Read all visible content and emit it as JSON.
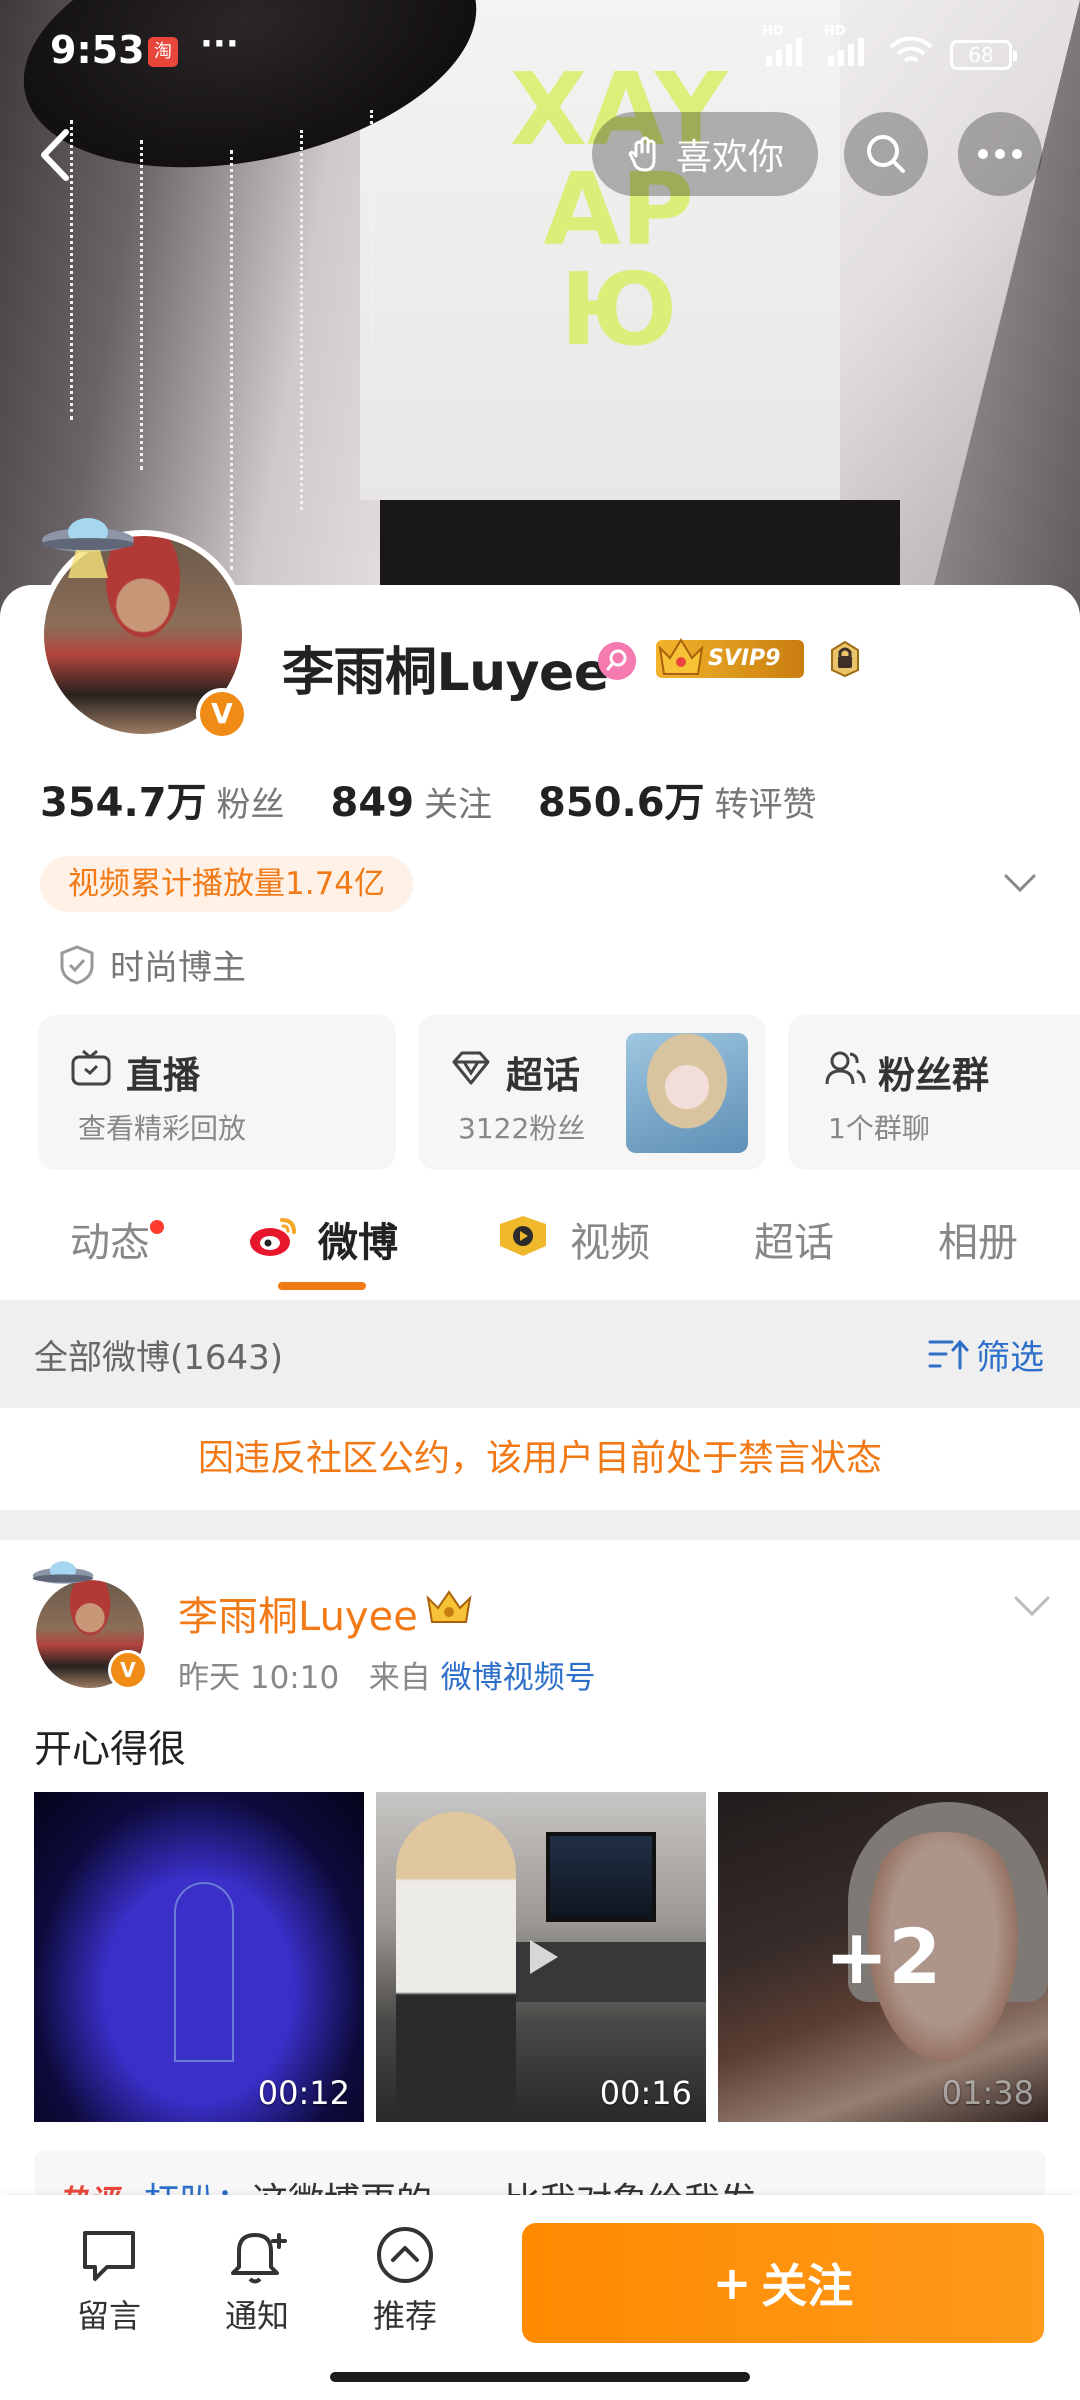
{
  "status_bar": {
    "time": "9:53",
    "app_icon_label": "淘",
    "more": "···",
    "battery": "68",
    "signal1_label": "HD",
    "signal2_label": "HD"
  },
  "header": {
    "like_label": "喜欢你",
    "shirt_text": [
      "XAY",
      "AP",
      "Ю"
    ]
  },
  "profile": {
    "name": "李雨桐Luyee",
    "svip_label": "SVIP9",
    "verified_badge": "V",
    "stats": [
      {
        "value": "354.7万",
        "label": "粉丝"
      },
      {
        "value": "849",
        "label": "关注"
      },
      {
        "value": "850.6万",
        "label": "转评赞"
      }
    ],
    "play_count": "视频累计播放量1.74亿",
    "tag": "时尚博主"
  },
  "features": [
    {
      "title": "直播",
      "sub": "查看精彩回放",
      "icon": "tv-icon"
    },
    {
      "title": "超话",
      "sub": "3122粉丝",
      "icon": "diamond-icon"
    },
    {
      "title": "粉丝群",
      "sub": "1个群聊",
      "icon": "group-icon"
    }
  ],
  "tabs": [
    {
      "label": "动态",
      "active": false
    },
    {
      "label": "微博",
      "active": true
    },
    {
      "label": "视频",
      "active": false
    },
    {
      "label": "超话",
      "active": false
    },
    {
      "label": "相册",
      "active": false
    }
  ],
  "feed": {
    "count_label": "全部微博(1643)",
    "filter_label": "筛选",
    "ban_notice": "因违反社区公约，该用户目前处于禁言状态"
  },
  "post": {
    "author": "李雨桐Luyee",
    "time": "昨天 10:10",
    "from_prefix": "来自",
    "source": "微博视频号",
    "text": "开心得很",
    "media": [
      {
        "duration": "00:12"
      },
      {
        "duration": "00:16"
      },
      {
        "duration": "01:38",
        "more": "+2"
      }
    ],
    "hot_comment": {
      "badge": "热评",
      "user": "杠叭：",
      "text": "这微博更的。。。比我对象给我发"
    }
  },
  "bottom_bar": {
    "items": [
      {
        "label": "留言",
        "icon": "message-icon"
      },
      {
        "label": "通知",
        "icon": "bell-plus-icon"
      },
      {
        "label": "推荐",
        "icon": "chevron-up-circle-icon"
      }
    ],
    "follow_label": "关注",
    "follow_plus": "+"
  },
  "colors": {
    "accent": "#f27a16",
    "link": "#2e6fc9",
    "follow_button": "#ff8a00",
    "verified": "#f08c16"
  }
}
